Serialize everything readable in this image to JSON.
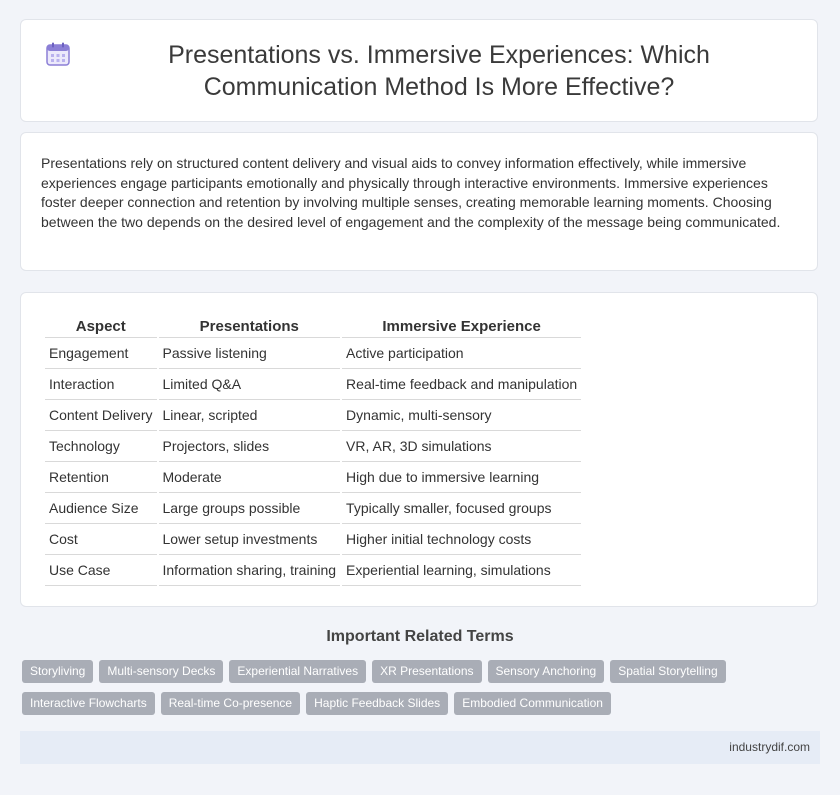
{
  "header": {
    "title": "Presentations vs. Immersive Experiences: Which Communication Method Is More Effective?",
    "icon": "calendar-icon"
  },
  "intro": "Presentations rely on structured content delivery and visual aids to convey information effectively, while immersive experiences engage participants emotionally and physically through interactive environments. Immersive experiences foster deeper connection and retention by involving multiple senses, creating memorable learning moments. Choosing between the two depends on the desired level of engagement and the complexity of the message being communicated.",
  "table": {
    "headers": [
      "Aspect",
      "Presentations",
      "Immersive Experience"
    ],
    "rows": [
      [
        "Engagement",
        "Passive listening",
        "Active participation"
      ],
      [
        "Interaction",
        "Limited Q&A",
        "Real-time feedback and manipulation"
      ],
      [
        "Content Delivery",
        "Linear, scripted",
        "Dynamic, multi-sensory"
      ],
      [
        "Technology",
        "Projectors, slides",
        "VR, AR, 3D simulations"
      ],
      [
        "Retention",
        "Moderate",
        "High due to immersive learning"
      ],
      [
        "Audience Size",
        "Large groups possible",
        "Typically smaller, focused groups"
      ],
      [
        "Cost",
        "Lower setup investments",
        "Higher initial technology costs"
      ],
      [
        "Use Case",
        "Information sharing, training",
        "Experiential learning, simulations"
      ]
    ]
  },
  "terms": {
    "title": "Important Related Terms",
    "items": [
      "Storyliving",
      "Multi-sensory Decks",
      "Experiential Narratives",
      "XR Presentations",
      "Sensory Anchoring",
      "Spatial Storytelling",
      "Interactive Flowcharts",
      "Real-time Co-presence",
      "Haptic Feedback Slides",
      "Embodied Communication"
    ]
  },
  "footer": {
    "site": "industrydif.com"
  },
  "colors": {
    "background": "#f2f4f9",
    "tag": "#a9adb6",
    "footer": "#e6ecf6",
    "icon_accent": "#8b7fd6"
  }
}
